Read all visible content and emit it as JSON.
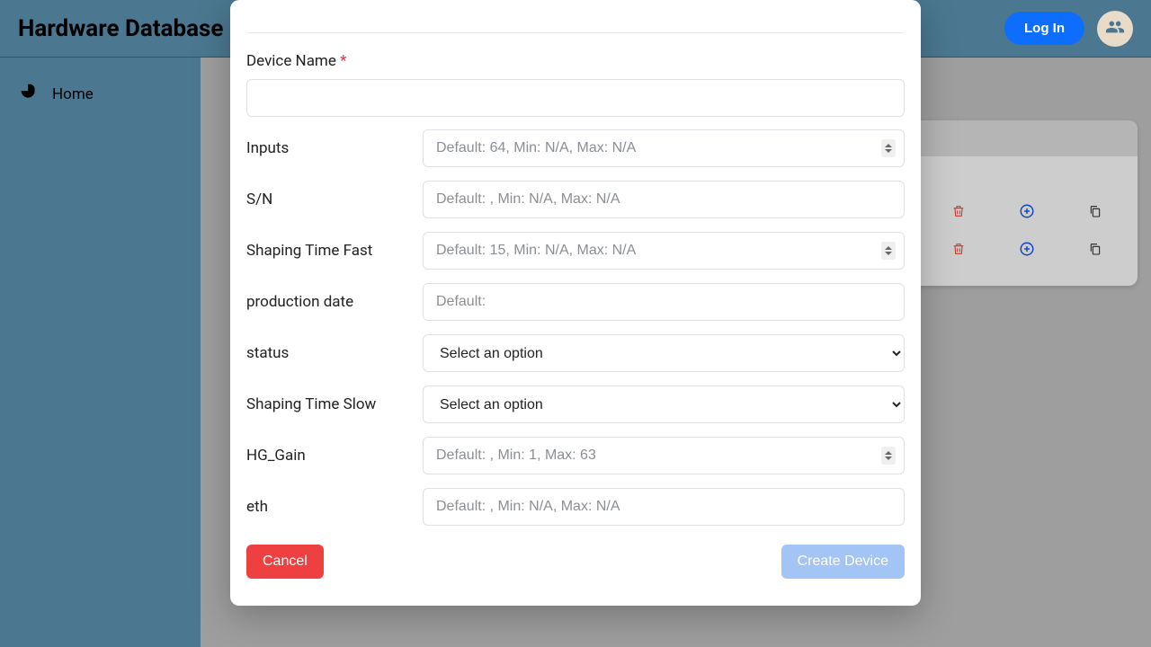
{
  "topbar": {
    "title": "Hardware Database",
    "login_label": "Log In"
  },
  "sidebar": {
    "items": [
      {
        "label": "Home"
      }
    ]
  },
  "modal": {
    "device_name_label": "Device Name",
    "required_mark": "*",
    "fields": {
      "inputs": {
        "label": "Inputs",
        "placeholder": "Default: 64, Min: N/A, Max: N/A",
        "type": "number"
      },
      "sn": {
        "label": "S/N",
        "placeholder": "Default: , Min: N/A, Max: N/A",
        "type": "text"
      },
      "shaping_fast": {
        "label": "Shaping Time Fast",
        "placeholder": "Default: 15, Min: N/A, Max: N/A",
        "type": "number"
      },
      "prod_date": {
        "label": "production date",
        "placeholder": "Default:",
        "type": "text"
      },
      "status": {
        "label": "status",
        "placeholder": "Select an option",
        "type": "select"
      },
      "shaping_slow": {
        "label": "Shaping Time Slow",
        "placeholder": "Select an option",
        "type": "select"
      },
      "hg_gain": {
        "label": "HG_Gain",
        "placeholder": "Default: , Min: 1, Max: 63",
        "type": "number"
      },
      "eth": {
        "label": "eth",
        "placeholder": "Default: , Min: N/A, Max: N/A",
        "type": "text"
      }
    },
    "cancel_label": "Cancel",
    "create_label": "Create Device"
  }
}
